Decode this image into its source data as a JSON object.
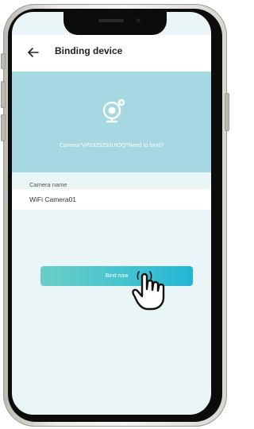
{
  "header": {
    "title": "Binding device",
    "back_icon": "arrow-left-icon"
  },
  "banner": {
    "icon": "camera-icon",
    "message": "Camera\"VP0325250UIOQ\"Need to bind?",
    "color": "#a5d8e0"
  },
  "form": {
    "camera_name_label": "Camera name",
    "camera_name_value": "WiFi Camera01"
  },
  "actions": {
    "bind_label": "Bind now",
    "gradient_start": "#6ccdc7",
    "gradient_end": "#22b6d6"
  },
  "overlay": {
    "icon": "pointing-hand-icon"
  }
}
